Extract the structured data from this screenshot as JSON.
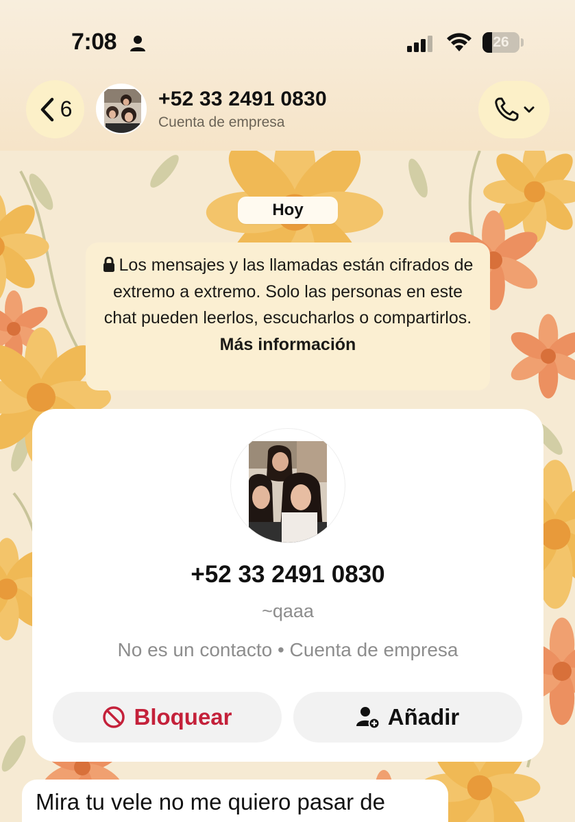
{
  "status_bar": {
    "time": "7:08",
    "battery_level": "26",
    "battery_fraction": 0.26,
    "icons": [
      "person-icon",
      "signal-icon",
      "wifi-icon",
      "battery-icon"
    ]
  },
  "header": {
    "back_count": "6",
    "contact_name": "+52 33 2491 0830",
    "subtitle": "Cuenta de empresa",
    "icons": [
      "chevron-left-icon",
      "phone-icon",
      "chevron-down-icon"
    ]
  },
  "chat": {
    "day_label": "Hoy",
    "encryption_notice": "Los mensajes y las llamadas están cifrados de extremo a extremo. Solo las personas en este chat pueden leerlos, escucharlos o compartirlos.",
    "encryption_more": "Más información",
    "contact_card": {
      "name": "+52 33 2491 0830",
      "alias": "~qaaa",
      "status": "No es un contacto • Cuenta de empresa",
      "block_label": "Bloquear",
      "add_label": "Añadir"
    },
    "first_message": "Mira tu vele no me quiero pasar de"
  },
  "colors": {
    "header_bg": "#f8eedd",
    "button_bg": "#fcf0c8",
    "notice_bg": "#fbefd2",
    "block_red": "#c4213a",
    "muted_text": "#8d8d8d"
  }
}
